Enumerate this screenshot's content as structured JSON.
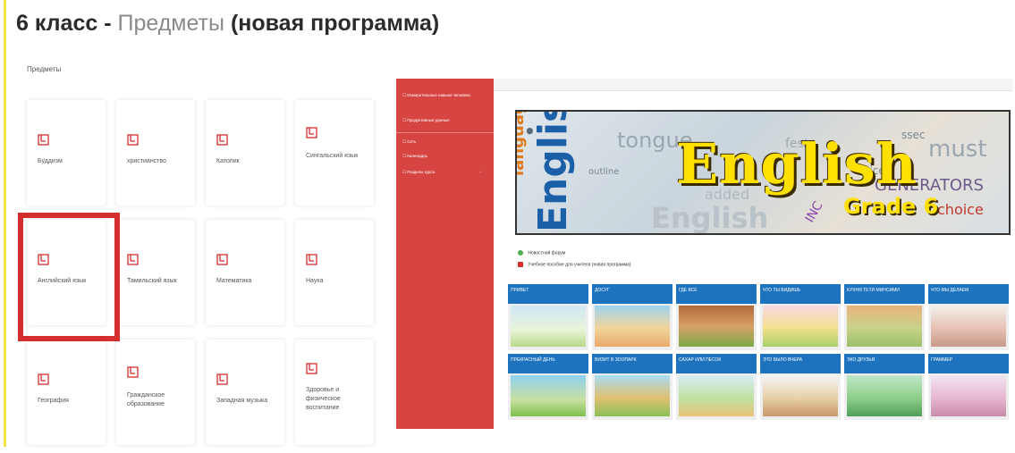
{
  "page": {
    "title_grade": "6 класс -",
    "title_subjects": "Предметы",
    "title_program": "(новая программа)",
    "breadcrumb": "Предметы"
  },
  "subjects": [
    {
      "label": "Буддизм"
    },
    {
      "label": "христианство"
    },
    {
      "label": "Католик"
    },
    {
      "label": "Сингальский язык"
    },
    {
      "label": "Английский язык"
    },
    {
      "label": "Тамильский язык"
    },
    {
      "label": "Математика"
    },
    {
      "label": "Наука"
    },
    {
      "label": "География"
    },
    {
      "label": "Гражданское образование"
    },
    {
      "label": "Западная музыка"
    },
    {
      "label": "Здоровье и физическое воспитание"
    }
  ],
  "course": {
    "sidebar": [
      {
        "label": "☐ Измерительные навыки человека"
      },
      {
        "label": "☐ Продуктивные данные"
      },
      {
        "label": "☐ Сеть"
      },
      {
        "label": "☐ Календарь"
      },
      {
        "label": "☐ Разделы курса"
      }
    ],
    "banner": {
      "title": "English",
      "grade": "Grade 6"
    },
    "resources": [
      {
        "label": "Новостной форум"
      },
      {
        "label": "Учебное пособие для учителя (новая программа)"
      }
    ],
    "units": [
      {
        "title": "ПРИВЕТ"
      },
      {
        "title": "ДОСУГ"
      },
      {
        "title": "ГДЕ ВСЕ"
      },
      {
        "title": "ЧТО ТЫ ВИДИШЬ"
      },
      {
        "title": "КУХНЯ ТЕТИ МИНСИМИ"
      },
      {
        "title": "ЧТО МЫ ДЕЛАЕМ"
      },
      {
        "title": "ПРЕКРАСНЫЙ ДЕНЬ"
      },
      {
        "title": "ВИЗИТ В ЗООПАРК"
      },
      {
        "title": "САХАР ИЛИ ПЕСОК"
      },
      {
        "title": "Это было вчера"
      },
      {
        "title": "ЭКО ДРУЗЬЯ"
      },
      {
        "title": "ГРАММЕР"
      }
    ]
  },
  "colors": {
    "accent_red": "#d42e2e",
    "sidebar_red": "#d64541",
    "unit_blue": "#1e73be",
    "banner_yellow": "#ffe000",
    "left_edge_yellow": "#f4e542"
  }
}
